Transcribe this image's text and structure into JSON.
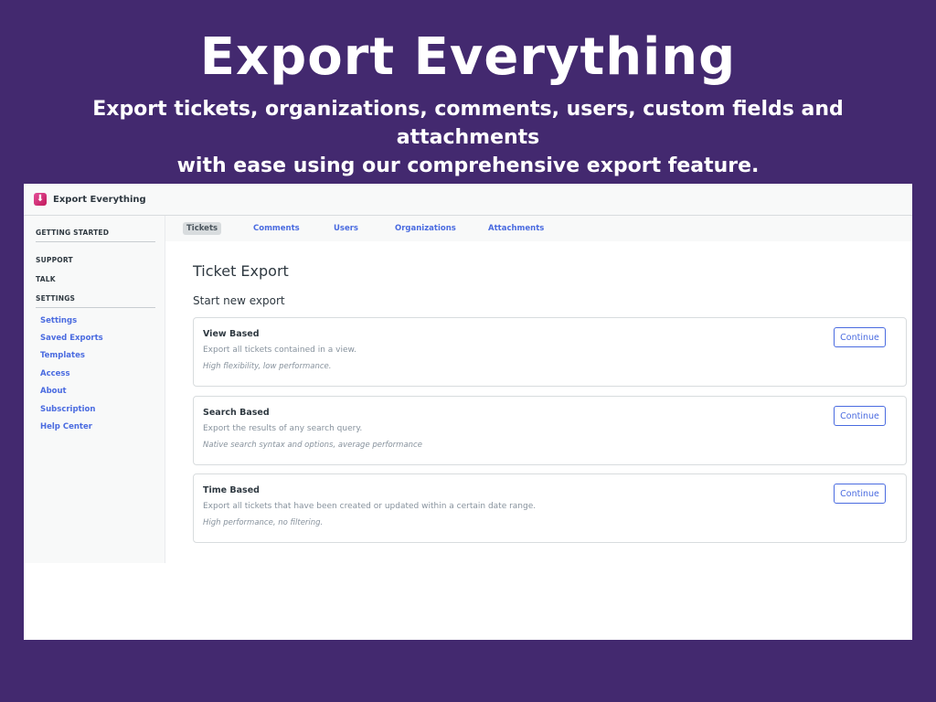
{
  "hero": {
    "title": "Export Everything",
    "subtitle_line1": "Export tickets, organizations, comments, users, custom fields and attachments",
    "subtitle_line2": "with ease using our comprehensive export feature."
  },
  "app": {
    "name": "Export Everything",
    "logo_icon": "download-icon",
    "accent_color": "#4a6be0",
    "background_color": "#43296f"
  },
  "sidebar": {
    "sections": {
      "getting_started": "GETTING STARTED",
      "support": "SUPPORT",
      "talk": "TALK",
      "settings": "SETTINGS"
    },
    "items": [
      {
        "label": "Settings"
      },
      {
        "label": "Saved Exports"
      },
      {
        "label": "Templates"
      },
      {
        "label": "Access"
      },
      {
        "label": "About"
      },
      {
        "label": "Subscription"
      },
      {
        "label": "Help Center"
      }
    ]
  },
  "tabs": [
    {
      "label": "Tickets",
      "active": true
    },
    {
      "label": "Comments",
      "active": false
    },
    {
      "label": "Users",
      "active": false
    },
    {
      "label": "Organizations",
      "active": false
    },
    {
      "label": "Attachments",
      "active": false
    }
  ],
  "main": {
    "title": "Ticket Export",
    "section_title": "Start new export",
    "cards": [
      {
        "title": "View Based",
        "description": "Export all tickets contained in a view.",
        "note": "High flexibility, low performance.",
        "button": "Continue"
      },
      {
        "title": "Search Based",
        "description": "Export the results of any search query.",
        "note": "Native search syntax and options, average performance",
        "button": "Continue"
      },
      {
        "title": "Time Based",
        "description": "Export all tickets that have been created or updated within a certain date range.",
        "note": "High performance, no filtering.",
        "button": "Continue"
      }
    ]
  }
}
